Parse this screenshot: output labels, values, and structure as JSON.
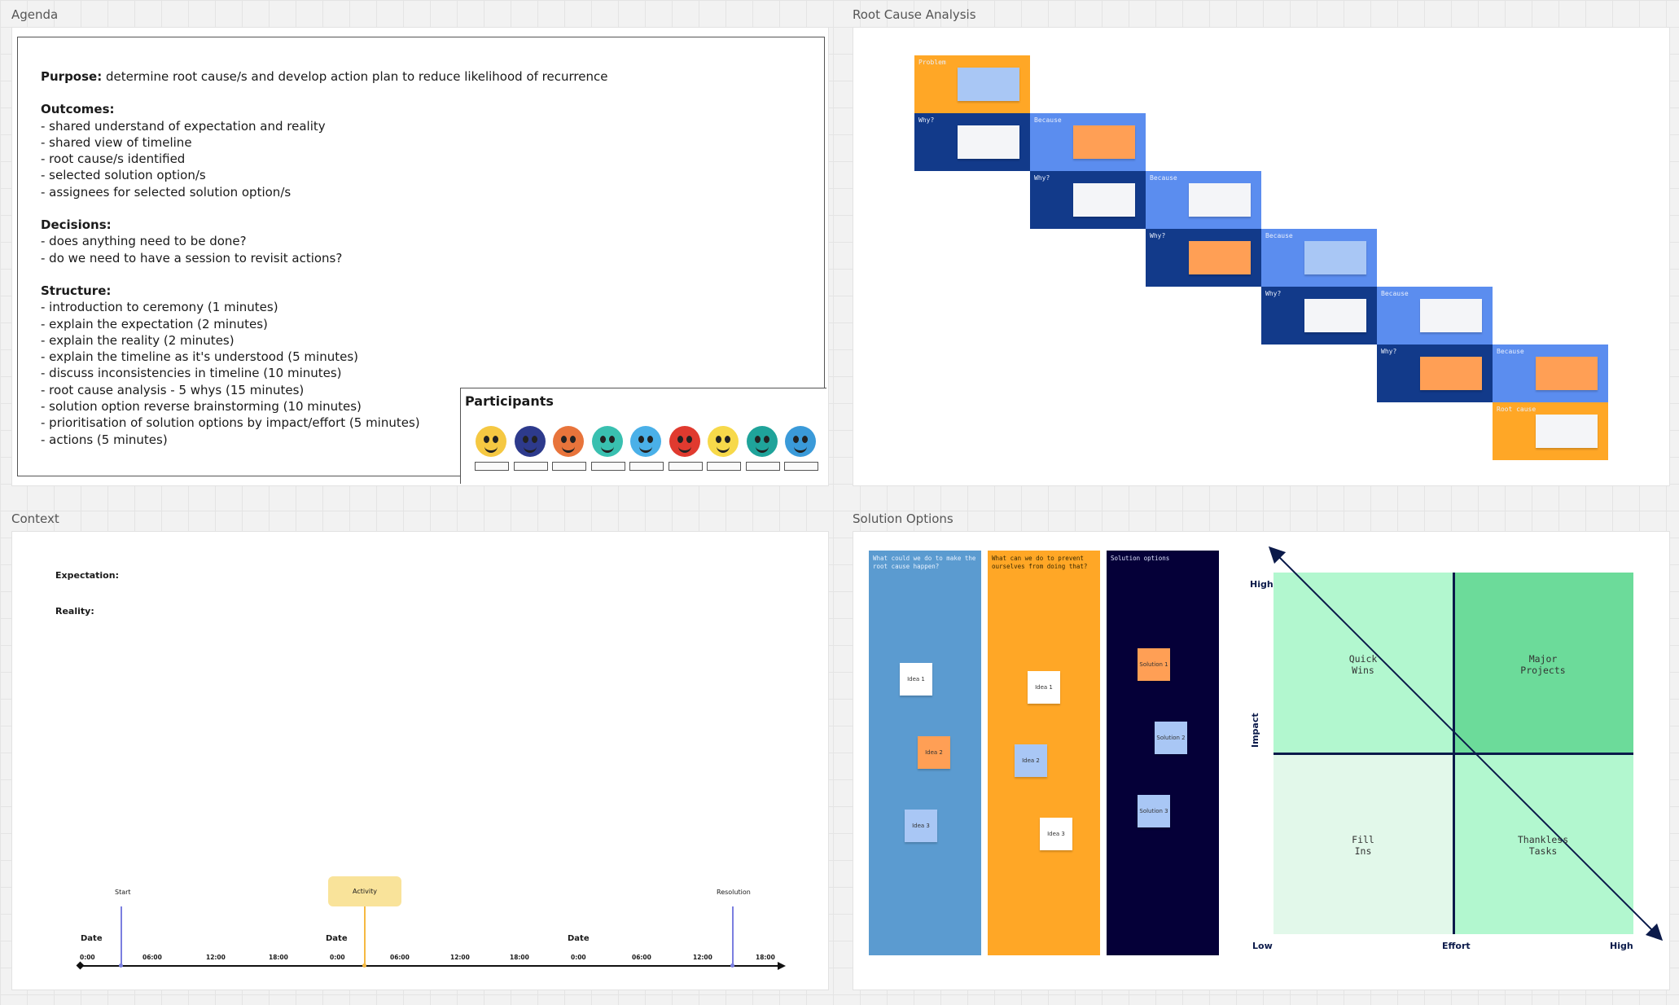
{
  "frames": {
    "agenda": "Agenda",
    "rca": "Root Cause Analysis",
    "context": "Context",
    "solutions": "Solution Options"
  },
  "agenda": {
    "purpose_label": "Purpose:",
    "purpose_text": " determine root cause/s and develop action plan to reduce likelihood of recurrence",
    "outcomes_label": "Outcomes:",
    "outcomes": [
      "- shared understand of expectation and reality",
      "- shared view of timeline",
      "- root cause/s identified",
      "- selected solution option/s",
      "- assignees for selected solution option/s"
    ],
    "decisions_label": "Decisions:",
    "decisions": [
      "- does anything need to be done?",
      "- do we need to have a session to revisit actions?"
    ],
    "structure_label": "Structure:",
    "structure": [
      "- introduction to ceremony (1 minutes)",
      "- explain the expectation (2 minutes)",
      "- explain the reality (2 minutes)",
      "- explain the timeline as it's understood (5 minutes)",
      "- discuss inconsistencies in timeline (10 minutes)",
      "- root cause analysis - 5 whys (15 minutes)",
      "- solution option reverse brainstorming (10 minutes)",
      "- prioritisation of solution options by impact/effort (5 minutes)",
      "- actions (5 minutes)"
    ],
    "participants_title": "Participants",
    "participant_colors": [
      "#f5c842",
      "#2d3a8c",
      "#e8743b",
      "#39c0b0",
      "#4ab0e8",
      "#e03a2f",
      "#f7d94a",
      "#1fa39a",
      "#3a9ad9"
    ]
  },
  "rca": {
    "problem_label": "Problem",
    "why_label": "Why?",
    "because_label": "Because",
    "root_cause_label": "Root cause",
    "colors": {
      "orange": "#ffa726",
      "dark_blue": "#123a8a",
      "light_blue": "#5b8def"
    }
  },
  "context": {
    "expectation_label": "Expectation:",
    "reality_label": "Reality:",
    "start_label": "Start",
    "activity_label": "Activity",
    "resolution_label": "Resolution",
    "date_label": "Date",
    "times": [
      "0:00",
      "06:00",
      "12:00",
      "18:00",
      "0:00",
      "06:00",
      "12:00",
      "18:00",
      "0:00",
      "06:00",
      "12:00",
      "18:00"
    ]
  },
  "solutions": {
    "col1_title": "What could we do to make the root cause happen?",
    "col2_title": "What can we do to prevent ourselves from doing that?",
    "col3_title": "Solution options",
    "col1_notes": [
      "Idea 1",
      "Idea 2",
      "Idea 3"
    ],
    "col2_notes": [
      "Idea 1",
      "Idea 2",
      "Idea 3"
    ],
    "col3_notes": [
      "Solution 1",
      "Solution 2",
      "Solution 3"
    ],
    "matrix": {
      "high_impact": "High",
      "impact": "Impact",
      "low": "Low",
      "effort": "Effort",
      "high_effort": "High",
      "quick_wins": "Quick\nWins",
      "major_projects": "Major\nProjects",
      "fill_ins": "Fill\nIns",
      "thankless_tasks": "Thankless\nTasks"
    }
  }
}
